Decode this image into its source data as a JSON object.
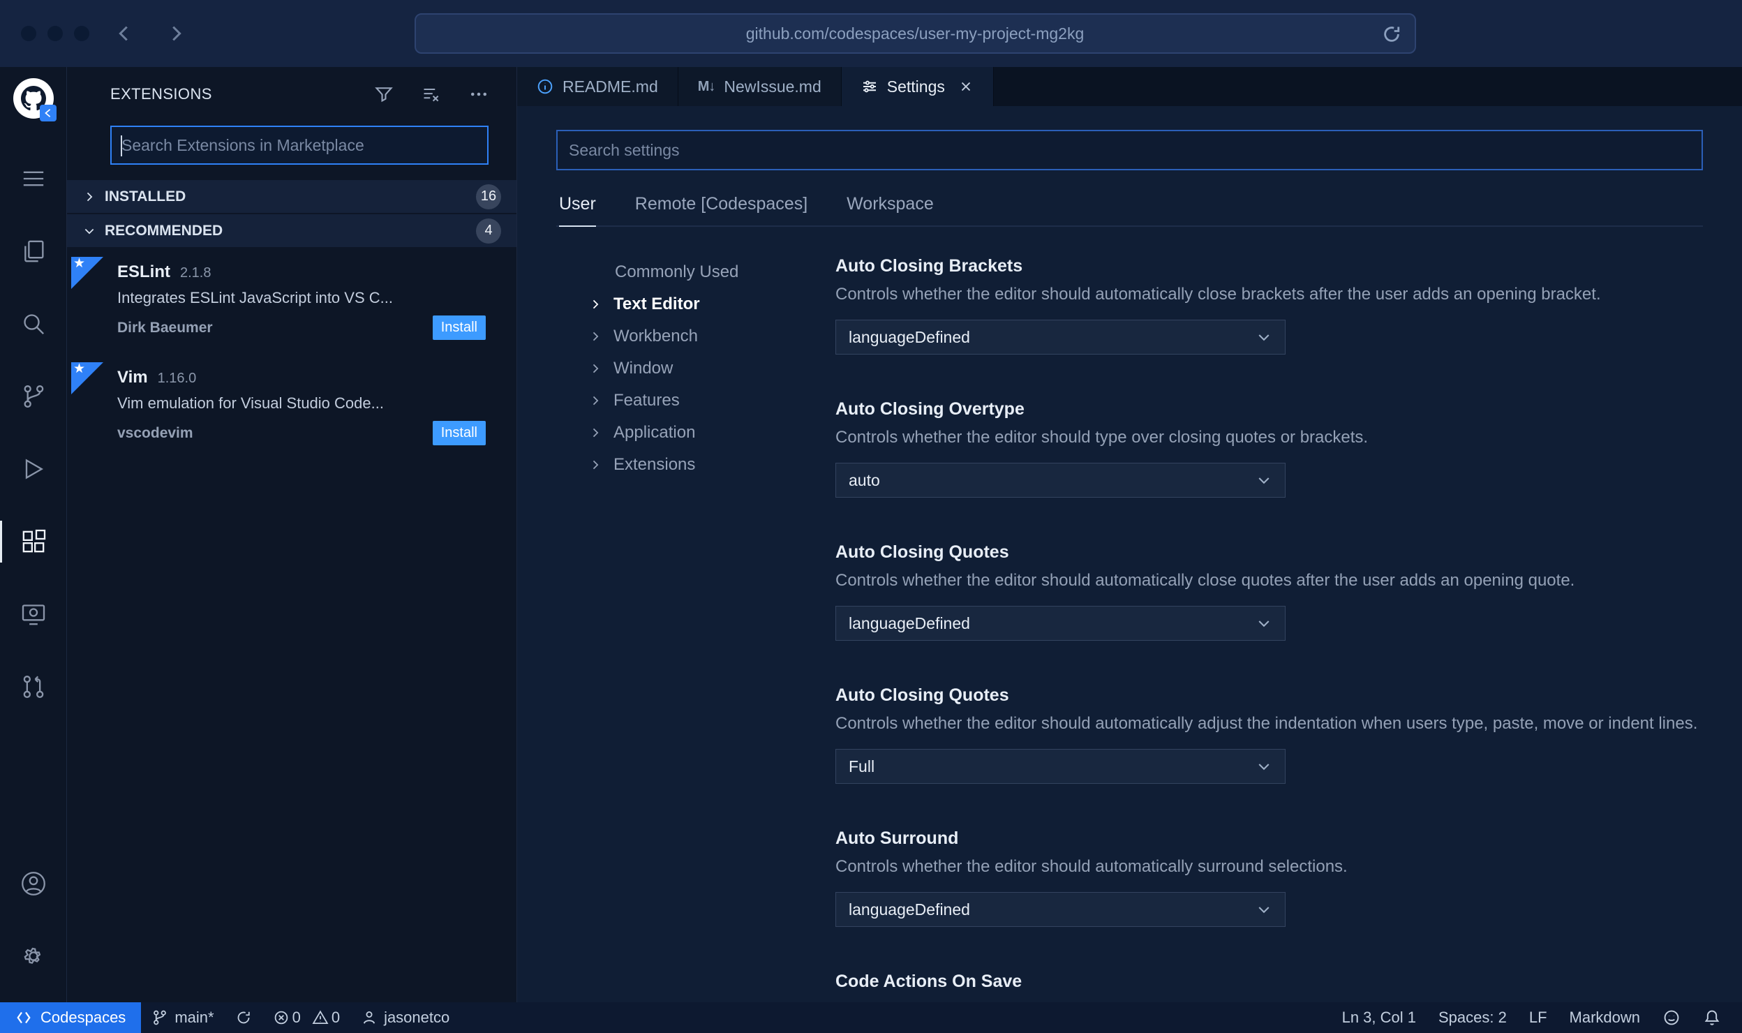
{
  "browser": {
    "url": "github.com/codespaces/user-my-project-mg2kg"
  },
  "icons": {
    "markdown": "M↓",
    "star": "★"
  },
  "sidebar": {
    "title": "EXTENSIONS",
    "search_placeholder": "Search Extensions in Marketplace",
    "sections": [
      {
        "label": "INSTALLED",
        "count": "16"
      },
      {
        "label": "RECOMMENDED",
        "count": "4"
      }
    ],
    "extensions": [
      {
        "name": "ESLint",
        "version": "2.1.8",
        "description": "Integrates ESLint JavaScript into VS C...",
        "publisher": "Dirk Baeumer",
        "action": "Install"
      },
      {
        "name": "Vim",
        "version": "1.16.0",
        "description": "Vim emulation for Visual Studio Code...",
        "publisher": "vscodevim",
        "action": "Install"
      }
    ]
  },
  "tabs": [
    {
      "label": "README.md"
    },
    {
      "label": "NewIssue.md"
    },
    {
      "label": "Settings"
    }
  ],
  "settings": {
    "search_placeholder": "Search settings",
    "scopes": [
      {
        "label": "User"
      },
      {
        "label": "Remote [Codespaces]"
      },
      {
        "label": "Workspace"
      }
    ],
    "toc": [
      {
        "label": "Commonly Used"
      },
      {
        "label": "Text Editor"
      },
      {
        "label": "Workbench"
      },
      {
        "label": "Window"
      },
      {
        "label": "Features"
      },
      {
        "label": "Application"
      },
      {
        "label": "Extensions"
      }
    ],
    "entries": [
      {
        "title": "Auto Closing Brackets",
        "description": "Controls whether the editor should automatically close brackets after the user adds an opening bracket.",
        "value": "languageDefined"
      },
      {
        "title": "Auto Closing Overtype",
        "description": "Controls whether the editor should type over closing quotes or brackets.",
        "value": "auto"
      },
      {
        "title": "Auto Closing Quotes",
        "description": "Controls whether the editor should automatically close quotes after the user adds an opening quote.",
        "value": "languageDefined"
      },
      {
        "title": "Auto Closing Quotes",
        "description": "Controls whether the editor should automatically adjust the indentation when users type, paste, move or indent lines.",
        "value": "Full"
      },
      {
        "title": "Auto Surround",
        "description": "Controls whether the editor should automatically surround selections.",
        "value": "languageDefined"
      },
      {
        "title": "Code Actions On Save"
      }
    ]
  },
  "status": {
    "codespaces": "Codespaces",
    "branch": "main*",
    "errors": "0",
    "warnings": "0",
    "user": "jasonetco",
    "line_col": "Ln 3, Col 1",
    "spaces": "Spaces: 2",
    "eol": "LF",
    "language": "Markdown"
  }
}
